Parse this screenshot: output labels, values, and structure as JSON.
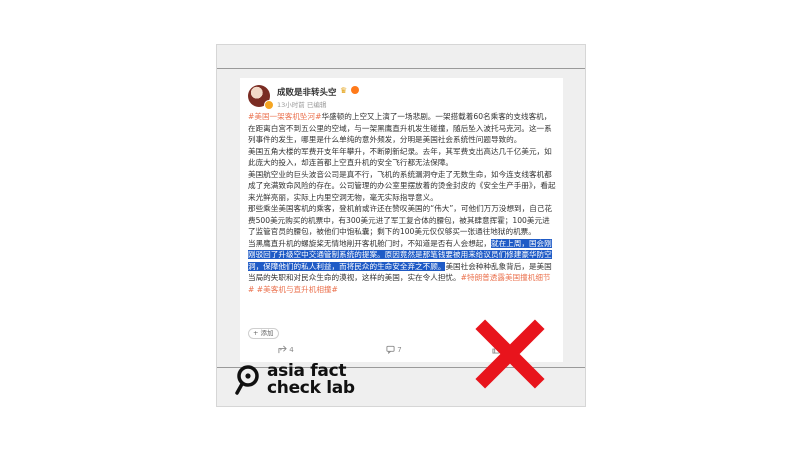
{
  "post": {
    "username": "成败是非转头空",
    "time": "13小时前",
    "edited": "已编辑",
    "paragraphs": [
      {
        "tag": "#美国一架客机坠河#",
        "text": "华盛顿的上空又上演了一场悲剧。一架搭载着60名乘客的支线客机，在距离白宫不到五公里的空域，与一架黑鹰直升机发生碰撞，随后坠入波托马克河。这一系列事件的发生，哪里是什么单纯的意外频发，分明是美国社会系统性问题导致的。"
      },
      {
        "text": "美国五角大楼的军费开支年年攀升，不断刷新纪录。去年，其军费支出高达几千亿美元，如此庞大的投入，却连首都上空直升机的安全飞行都无法保障。"
      },
      {
        "text": "美国航空业的巨头波音公司是真不行，飞机的系统漏洞夺走了无数生命，如今连支线客机都成了充满致命风险的存在。公司管理的办公室里摆放着的烫金封皮的《安全生产手册》，看起来光鲜亮丽，实际上内里空洞无物，毫无实际指导意义。"
      },
      {
        "text": "那些乘坐美国客机的乘客，登机前或许还在赞叹美国的“伟大”，可他们万万没想到，自己花费500美元购买的机票中，有300美元进了军工复合体的腰包，被其肆意挥霍；100美元进了监管官员的腰包，被他们中饱私囊；剩下的100美元仅仅够买一张通往地狱的机票。"
      },
      {
        "text_before": "当黑鹰直升机的螺旋桨无情地削开客机舱门时，不知道是否有人会想起，",
        "highlight": "就在上周，国会刚刚驳回了升级空中交通管制系统的提案。原因竟然是那笔钱要被用来给议员们修建豪华防空洞，保障他们的私人利益，而将民众的生命安全弃之不顾。",
        "text_after": "美国社会种种乱象背后，是美国当局的失职和对民众生命的漠视，这样的美国，实在令人担忧。",
        "tags": [
          "#特朗普透露美国撞机细节#",
          "#美客机与直升机相撞#"
        ]
      }
    ],
    "add_label": "+ 添加",
    "shares": "4",
    "comments": "7",
    "likes": ""
  },
  "brand": {
    "line1": "asia fact",
    "line2": "check lab"
  },
  "colors": {
    "highlight": "#1f5bc6",
    "tag": "#eb7350",
    "verdict": "#e8141c"
  },
  "verdict_icon": "red-x-false-icon"
}
